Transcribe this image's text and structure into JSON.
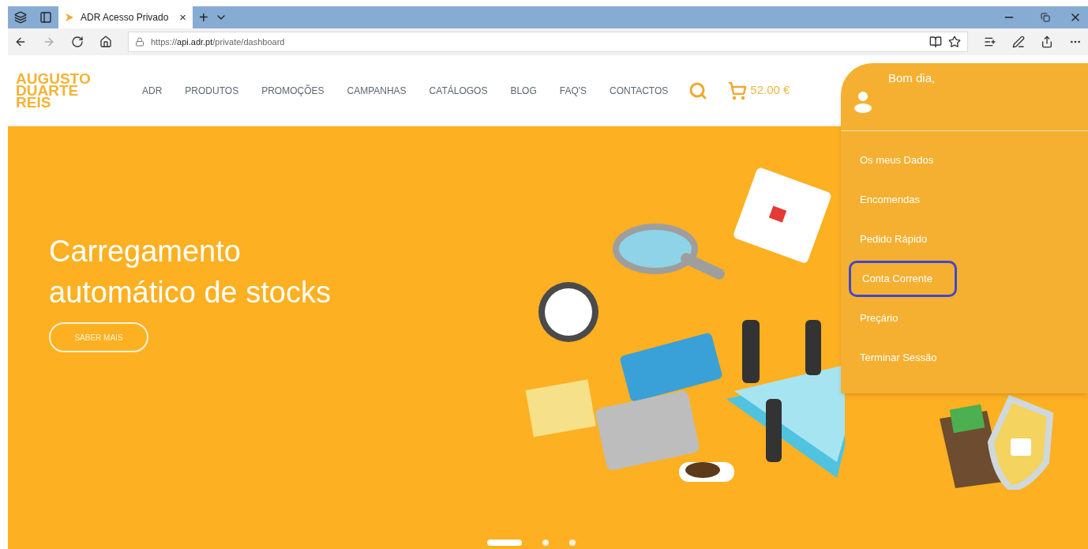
{
  "browser": {
    "tab_title": "ADR Acesso Privado",
    "tab_close": "×",
    "new_tab": "+",
    "url_host": "api.adr.pt",
    "url_prefix": "https://",
    "url_path": "/private/dashboard"
  },
  "site": {
    "logo_lines": [
      "AUGUSTO",
      "DUARTE",
      "REIS"
    ],
    "nav": [
      {
        "label": "ADR"
      },
      {
        "label": "PRODUTOS"
      },
      {
        "label": "PROMOÇÕES"
      },
      {
        "label": "CAMPANHAS"
      },
      {
        "label": "CATÁLOGOS"
      },
      {
        "label": "BLOG"
      },
      {
        "label": "FAQ'S"
      },
      {
        "label": "CONTACTOS"
      }
    ],
    "cart_total": "52.00 €"
  },
  "user_menu": {
    "greeting": "Bom dia,",
    "items": [
      {
        "label": "Os meus Dados",
        "highlighted": false
      },
      {
        "label": "Encomendas",
        "highlighted": false
      },
      {
        "label": "Pedido Rápido",
        "highlighted": false
      },
      {
        "label": "Conta Corrente",
        "highlighted": true
      },
      {
        "label": "Preçário",
        "highlighted": false
      },
      {
        "label": "Terminar Sessão",
        "highlighted": false
      }
    ]
  },
  "hero": {
    "title_lines": [
      "Carregamento",
      "automático de stocks"
    ],
    "button": "SABER MAIS",
    "slides": [
      {
        "selected": true
      },
      {
        "selected": false
      },
      {
        "selected": false
      }
    ]
  }
}
